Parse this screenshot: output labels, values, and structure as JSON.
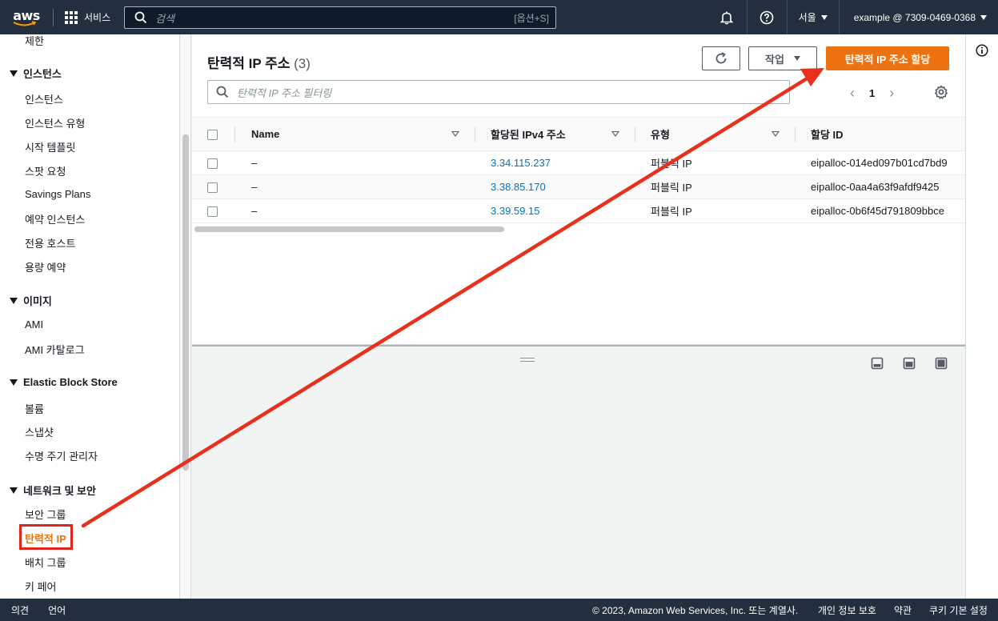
{
  "topnav": {
    "logo": "aws",
    "services_label": "서비스",
    "search_placeholder": "검색",
    "search_hint": "[옵션+S]",
    "region": "서울",
    "account": "example @ 7309-0469-0368"
  },
  "sidebar": {
    "top_item": "제한",
    "sections": [
      {
        "label": "인스턴스",
        "items": [
          "인스턴스",
          "인스턴스 유형",
          "시작 템플릿",
          "스팟 요청",
          "Savings Plans",
          "예약 인스턴스",
          "전용 호스트",
          "용량 예약"
        ]
      },
      {
        "label": "이미지",
        "items": [
          "AMI",
          "AMI 카탈로그"
        ]
      },
      {
        "label": "Elastic Block Store",
        "items": [
          "볼륨",
          "스냅샷",
          "수명 주기 관리자"
        ]
      },
      {
        "label": "네트워크 및 보안",
        "items": [
          "보안 그룹",
          "탄력적 IP",
          "배치 그룹",
          "키 페어"
        ]
      }
    ]
  },
  "main": {
    "title": "탄력적 IP 주소",
    "count": "(3)",
    "action_label": "작업",
    "primary_label": "탄력적 IP 주소 할당",
    "filter_placeholder": "탄력적 IP 주소 필터링",
    "page": "1",
    "columns": [
      "Name",
      "할당된 IPv4 주소",
      "유형",
      "할당 ID"
    ],
    "rows": [
      {
        "name": "–",
        "ip": "3.34.115.237",
        "type": "퍼블릭 IP",
        "id": "eipalloc-014ed097b01cd7bd9"
      },
      {
        "name": "–",
        "ip": "3.38.85.170",
        "type": "퍼블릭 IP",
        "id": "eipalloc-0aa4a63f9afdf9425"
      },
      {
        "name": "–",
        "ip": "3.39.59.15",
        "type": "퍼블릭 IP",
        "id": "eipalloc-0b6f45d791809bbce"
      }
    ]
  },
  "footer": {
    "feedback": "의견",
    "language": "언어",
    "copyright": "© 2023, Amazon Web Services, Inc. 또는 계열사.",
    "privacy": "개인 정보 보호",
    "terms": "약관",
    "cookies": "쿠키 기본 설정"
  },
  "colors": {
    "nav_bg": "#232f3e",
    "accent": "#ec7211",
    "link": "#0073bb",
    "annotation_arrow": "#e8301c"
  }
}
